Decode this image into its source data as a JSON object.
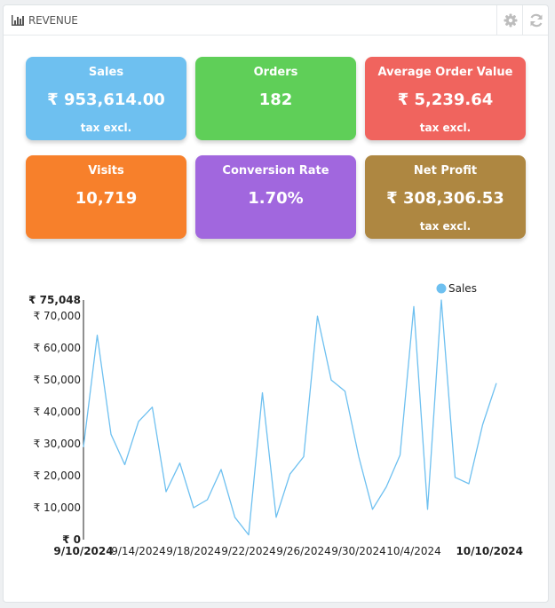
{
  "header": {
    "title": "REVENUE",
    "title_icon": "bar-chart-icon",
    "tools": [
      {
        "name": "config-button",
        "icon": "gear-icon"
      },
      {
        "name": "refresh-button",
        "icon": "refresh-icon"
      }
    ]
  },
  "kpis": {
    "sales": {
      "label": "Sales",
      "value": "₹ 953,614.00",
      "sub": "tax excl.",
      "color": "#6ec0f0"
    },
    "orders": {
      "label": "Orders",
      "value": "182",
      "sub": "",
      "color": "#5fcf58"
    },
    "aov": {
      "label": "Average Order Value",
      "value": "₹ 5,239.64",
      "sub": "tax excl.",
      "color": "#f0645e"
    },
    "visits": {
      "label": "Visits",
      "value": "10,719",
      "sub": "",
      "color": "#f7802b"
    },
    "conversion": {
      "label": "Conversion Rate",
      "value": "1.70%",
      "sub": "",
      "color": "#a167de"
    },
    "profit": {
      "label": "Net Profit",
      "value": "₹ 308,306.53",
      "sub": "tax excl.",
      "color": "#ae8741"
    }
  },
  "chart_data": {
    "type": "line",
    "legend_position": "top-right",
    "series": [
      {
        "name": "Sales",
        "color": "#6ec0f0",
        "values": [
          29000,
          64000,
          33000,
          23500,
          37000,
          41500,
          15000,
          24000,
          10000,
          12500,
          22000,
          7000,
          1500,
          46000,
          7000,
          20500,
          26000,
          70000,
          50000,
          46500,
          26000,
          9500,
          16500,
          26500,
          73000,
          9500,
          75048,
          19500,
          17500,
          36000,
          49000
        ]
      }
    ],
    "x": [
      "9/10/2024",
      "9/11/2024",
      "9/12/2024",
      "9/13/2024",
      "9/14/2024",
      "9/15/2024",
      "9/16/2024",
      "9/17/2024",
      "9/18/2024",
      "9/19/2024",
      "9/20/2024",
      "9/21/2024",
      "9/22/2024",
      "9/23/2024",
      "9/24/2024",
      "9/25/2024",
      "9/26/2024",
      "9/27/2024",
      "9/28/2024",
      "9/29/2024",
      "9/30/2024",
      "10/1/2024",
      "10/2/2024",
      "10/3/2024",
      "10/4/2024",
      "10/5/2024",
      "10/6/2024",
      "10/7/2024",
      "10/8/2024",
      "10/9/2024",
      "10/10/2024"
    ],
    "x_tick_labels": [
      "9/14/2024",
      "9/18/2024",
      "9/22/2024",
      "9/26/2024",
      "9/30/2024",
      "10/4/2024"
    ],
    "x_start_label": "9/10/2024",
    "x_end_label": "10/10/2024",
    "ylim": [
      0,
      75048
    ],
    "y_tick_labels": [
      "₹ 10,000",
      "₹ 20,000",
      "₹ 30,000",
      "₹ 40,000",
      "₹ 50,000",
      "₹ 60,000",
      "₹ 70,000"
    ],
    "y_max_label": "₹ 75,048",
    "y_min_label": "₹ 0",
    "grid": false
  }
}
